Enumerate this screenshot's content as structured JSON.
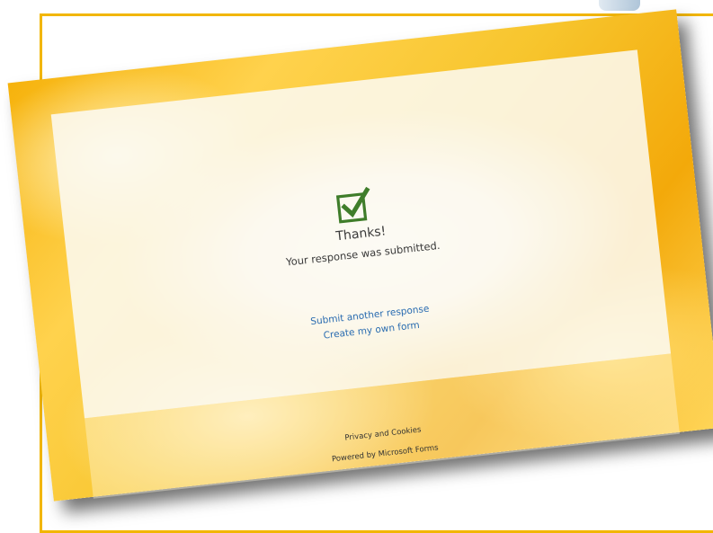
{
  "confirmation": {
    "title": "Thanks!",
    "message": "Your response was submitted.",
    "icon": "checkmark-box-icon",
    "icon_color": "#3f7d2a"
  },
  "links": {
    "submit_another": "Submit another response",
    "create_form": "Create my own form"
  },
  "footer": {
    "privacy": "Privacy and Cookies",
    "powered_by": "Powered by Microsoft Forms"
  },
  "colors": {
    "frame": "#f2b600",
    "link": "#2a6cb0"
  }
}
